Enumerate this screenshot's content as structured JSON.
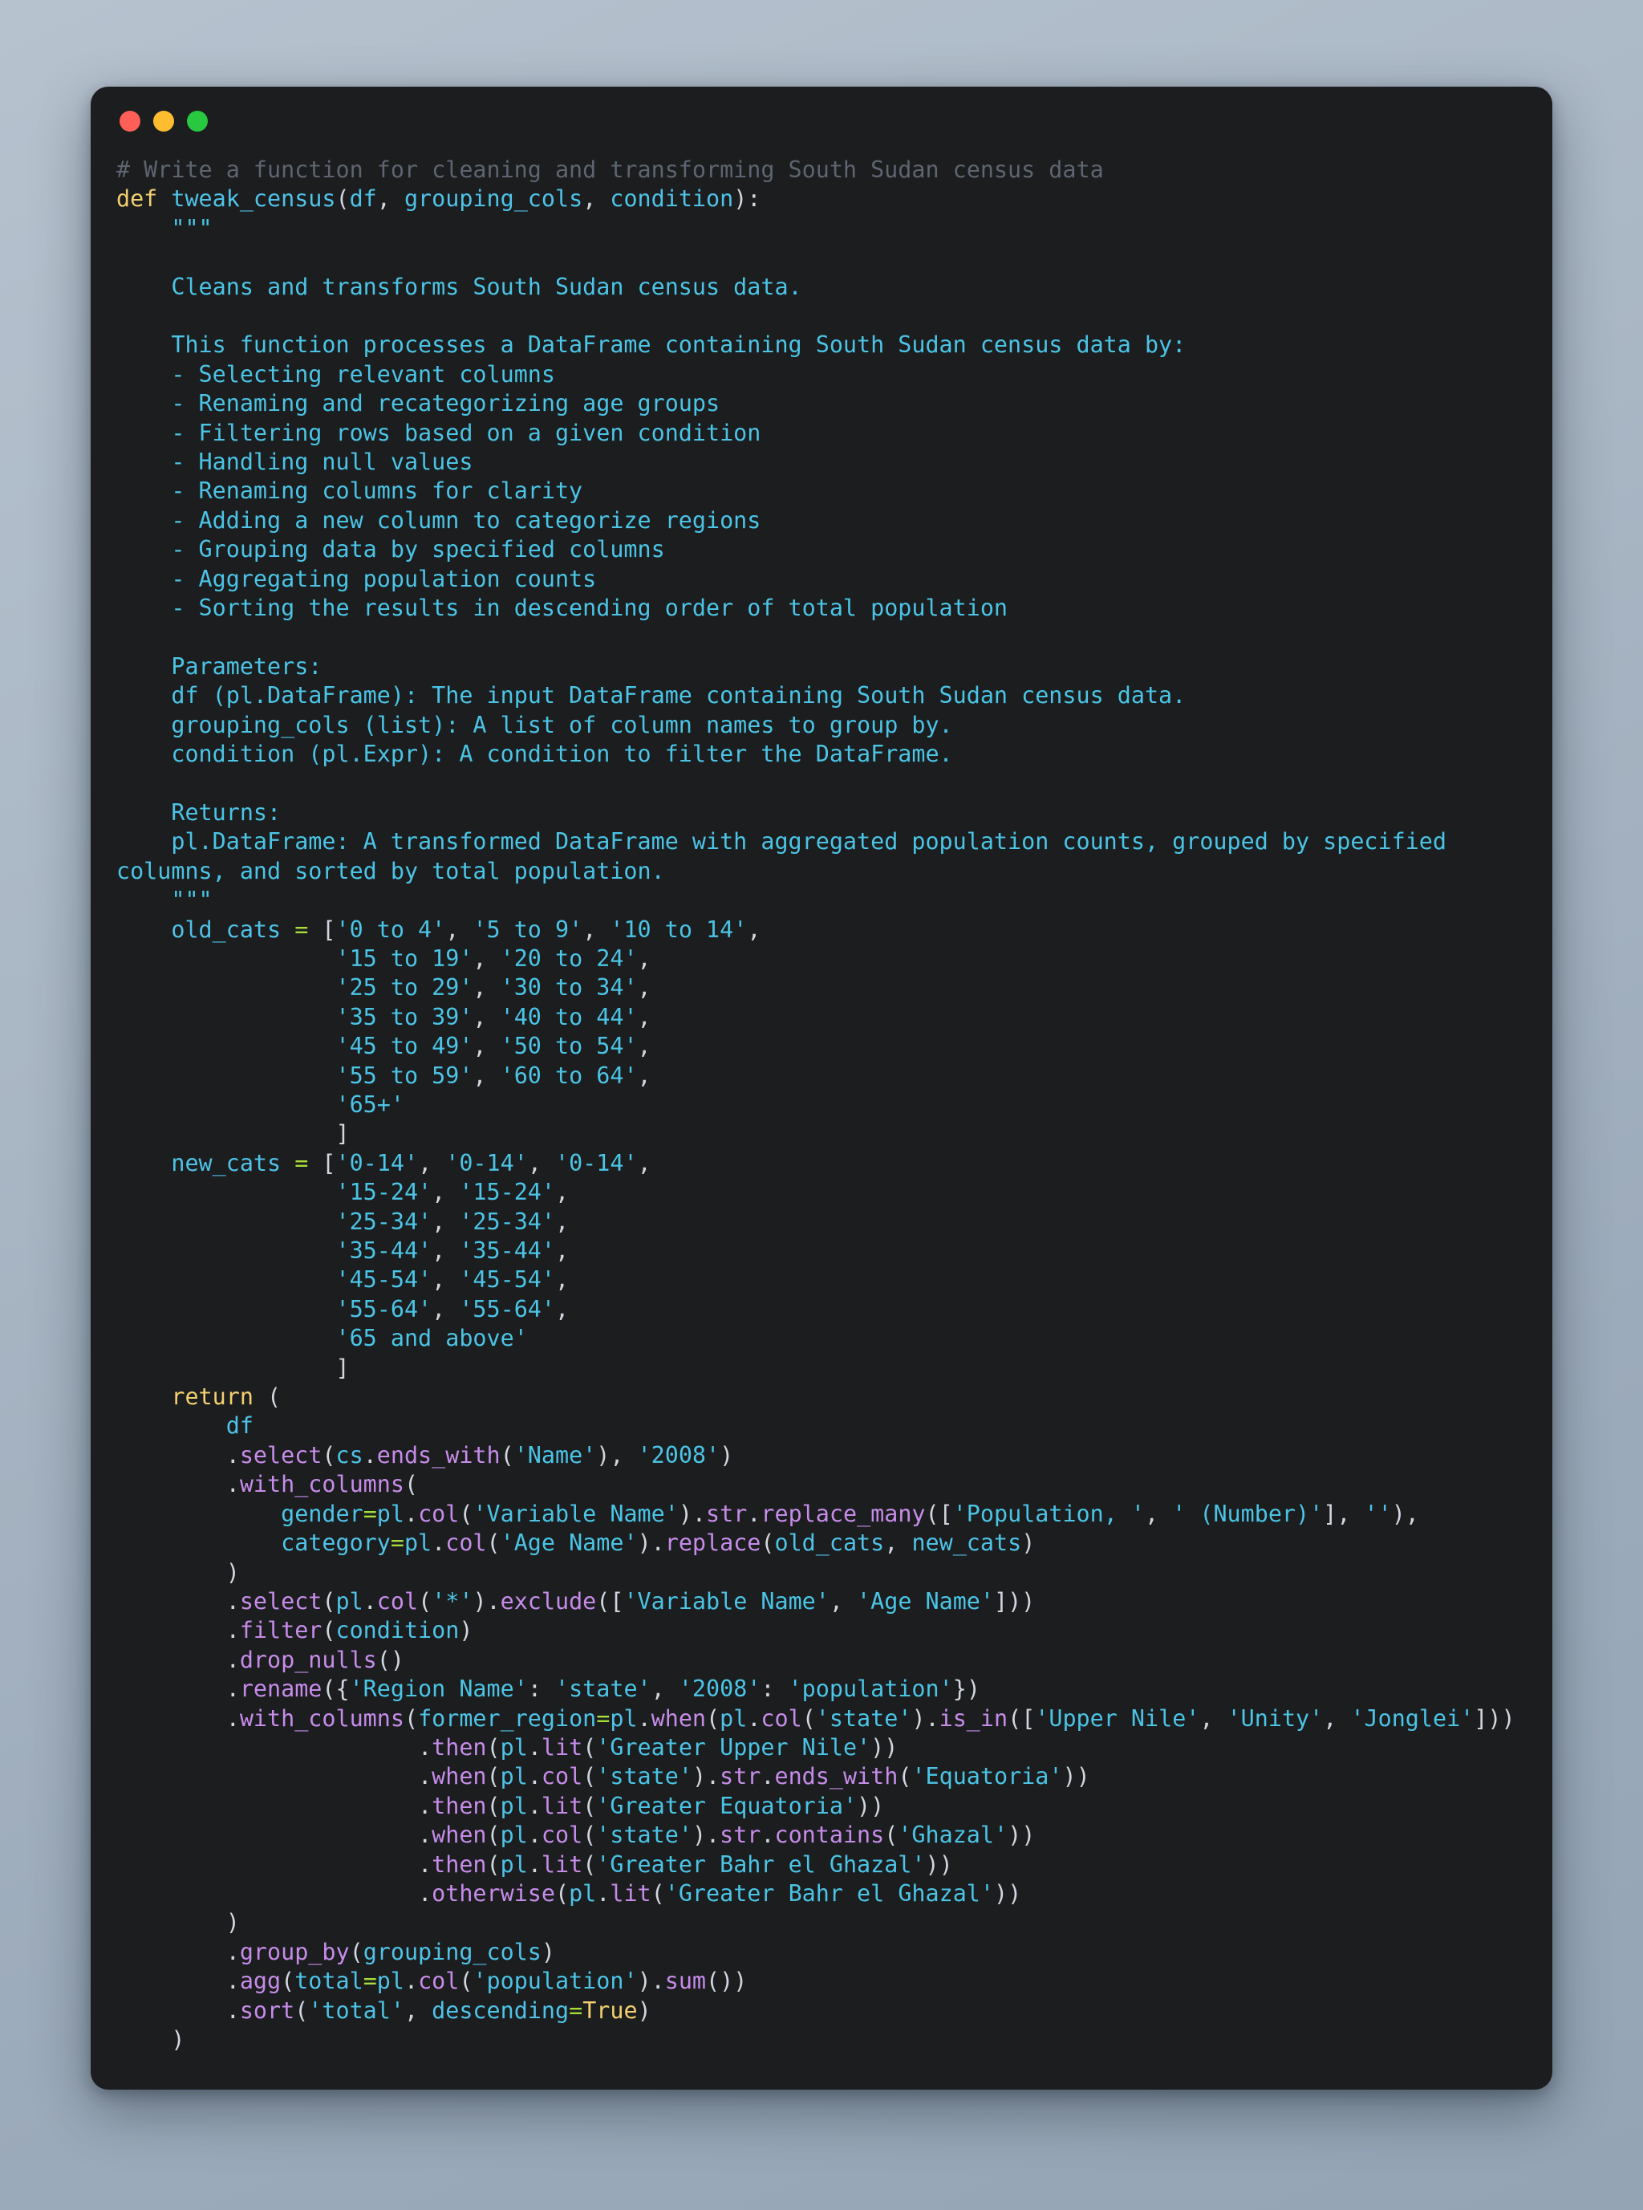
{
  "window": {
    "traffic_lights": [
      {
        "name": "close-button",
        "color": "#ff5f57"
      },
      {
        "name": "minimize-button",
        "color": "#febc2e"
      },
      {
        "name": "maximize-button",
        "color": "#28c840"
      }
    ],
    "background_gradient_from": "#b6c2ce",
    "background_gradient_to": "#94a4b4",
    "card_background": "#1b1d1e"
  },
  "theme": {
    "comment": "#5e6570",
    "keyword": "#f3d070",
    "identifier": "#4fc3e8",
    "string": "#4bc4e6",
    "method": "#c78cea",
    "operator": "#a9dd3b",
    "punctuation": "#d2d7df"
  },
  "code": {
    "language": "python",
    "comment_line": "# Write a function for cleaning and transforming South Sudan census data",
    "signature": {
      "keyword": "def",
      "name": "tweak_census",
      "params": [
        "df",
        "grouping_cols",
        "condition"
      ]
    },
    "docstring": {
      "quote": "\"\"\"",
      "summary": "Cleans and transforms South Sudan census data.",
      "intro": "This function processes a DataFrame containing South Sudan census data by:",
      "bullets": [
        "- Selecting relevant columns",
        "- Renaming and recategorizing age groups",
        "- Filtering rows based on a given condition",
        "- Handling null values",
        "- Renaming columns for clarity",
        "- Adding a new column to categorize regions",
        "- Grouping data by specified columns",
        "- Aggregating population counts",
        "- Sorting the results in descending order of total population"
      ],
      "parameters_heading": "Parameters:",
      "parameters": [
        "df (pl.DataFrame): The input DataFrame containing South Sudan census data.",
        "grouping_cols (list): A list of column names to group by.",
        "condition (pl.Expr): A condition to filter the DataFrame."
      ],
      "returns_heading": "Returns:",
      "returns": "pl.DataFrame: A transformed DataFrame with aggregated population counts, grouped by specified columns, and sorted by total population."
    },
    "old_cats": {
      "name": "old_cats",
      "values": [
        "'0 to 4'",
        "'5 to 9'",
        "'10 to 14'",
        "'15 to 19'",
        "'20 to 24'",
        "'25 to 29'",
        "'30 to 34'",
        "'35 to 39'",
        "'40 to 44'",
        "'45 to 49'",
        "'50 to 54'",
        "'55 to 59'",
        "'60 to 64'",
        "'65+'"
      ]
    },
    "new_cats": {
      "name": "new_cats",
      "values": [
        "'0-14'",
        "'0-14'",
        "'0-14'",
        "'15-24'",
        "'15-24'",
        "'25-34'",
        "'25-34'",
        "'35-44'",
        "'35-44'",
        "'45-54'",
        "'45-54'",
        "'55-64'",
        "'55-64'",
        "'65 and above'"
      ]
    },
    "return_keyword": "return",
    "chain": [
      "df",
      ".select(cs.ends_with('Name'), '2008')",
      ".with_columns(",
      "    gender=pl.col('Variable Name').str.replace_many(['Population, ', ' (Number)'], ''),",
      "    category=pl.col('Age Name').replace(old_cats, new_cats)",
      ")",
      ".select(pl.col('*').exclude(['Variable Name', 'Age Name']))",
      ".filter(condition)",
      ".drop_nulls()",
      ".rename({'Region Name': 'state', '2008': 'population'})",
      ".with_columns(former_region=pl.when(pl.col('state').is_in(['Upper Nile', 'Unity', 'Jonglei']))",
      "              .then(pl.lit('Greater Upper Nile'))",
      "              .when(pl.col('state').str.ends_with('Equatoria'))",
      "              .then(pl.lit('Greater Equatoria'))",
      "              .when(pl.col('state').str.contains('Ghazal'))",
      "              .then(pl.lit('Greater Bahr el Ghazal'))",
      "              .otherwise(pl.lit('Greater Bahr el Ghazal'))",
      ")",
      ".group_by(grouping_cols)",
      ".agg(total=pl.col('population').sum())",
      ".sort('total', descending=True)",
      ")"
    ]
  }
}
